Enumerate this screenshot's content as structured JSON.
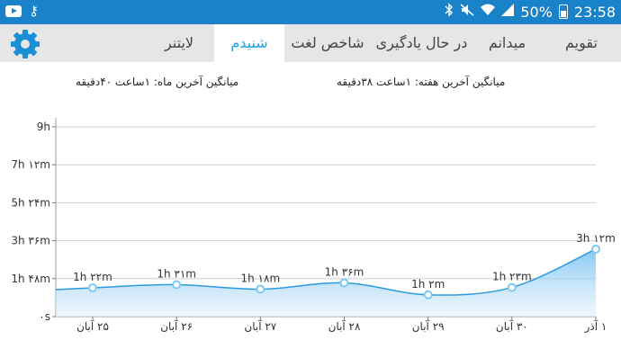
{
  "status_bar": {
    "battery_percent": "50%",
    "time": "23:58",
    "left_icons": [
      "youtube-icon",
      "key-icon"
    ],
    "right_icons": [
      "bluetooth-icon",
      "mute-icon",
      "wifi-icon",
      "signal-icon",
      "battery-icon"
    ]
  },
  "tabs": [
    {
      "label": "تقویم",
      "active": false
    },
    {
      "label": "میدانم",
      "active": false
    },
    {
      "label": "در حال یادگیری",
      "active": false
    },
    {
      "label": "شاخص لغت",
      "active": false
    },
    {
      "label": "شنیدم",
      "active": true
    },
    {
      "label": "لایتنر",
      "active": false
    }
  ],
  "settings_icon": "gear-icon",
  "averages": {
    "week": "میانگین آخرین هفته: ۱ساعت  ۳۸دقیقه",
    "month": "میانگین آخرین ماه: ۱ساعت  ۴۰دقیقه"
  },
  "colors": {
    "status_bar": "#1a82c9",
    "tab_bar": "#e6e6e6",
    "active_tab_text": "#1da1e6",
    "line": "#2b9be0",
    "fill_top": "#7cc3f3",
    "fill_bottom": "#e3f2fc"
  },
  "chart_data": {
    "type": "area",
    "y_ticks": [
      "۰s",
      "1h ۴۸m",
      "3h ۳۶m",
      "5h ۲۴m",
      "7h ۱۲m",
      "9h"
    ],
    "y_range_minutes": [
      0,
      540
    ],
    "categories": [
      "۲۵ آبان",
      "۲۶ آبان",
      "۲۷ آبان",
      "۲۸ آبان",
      "۲۹ آبان",
      "۳۰ آبان",
      "۱ آذر"
    ],
    "values_minutes": [
      82,
      91,
      78,
      96,
      62,
      83,
      192
    ],
    "point_labels": [
      "1h ۲۲m",
      "1h ۳۱m",
      "1h ۱۸m",
      "1h ۳۶m",
      "1h ۲m",
      "1h ۲۳m",
      "3h ۱۲m"
    ],
    "grid": true
  }
}
